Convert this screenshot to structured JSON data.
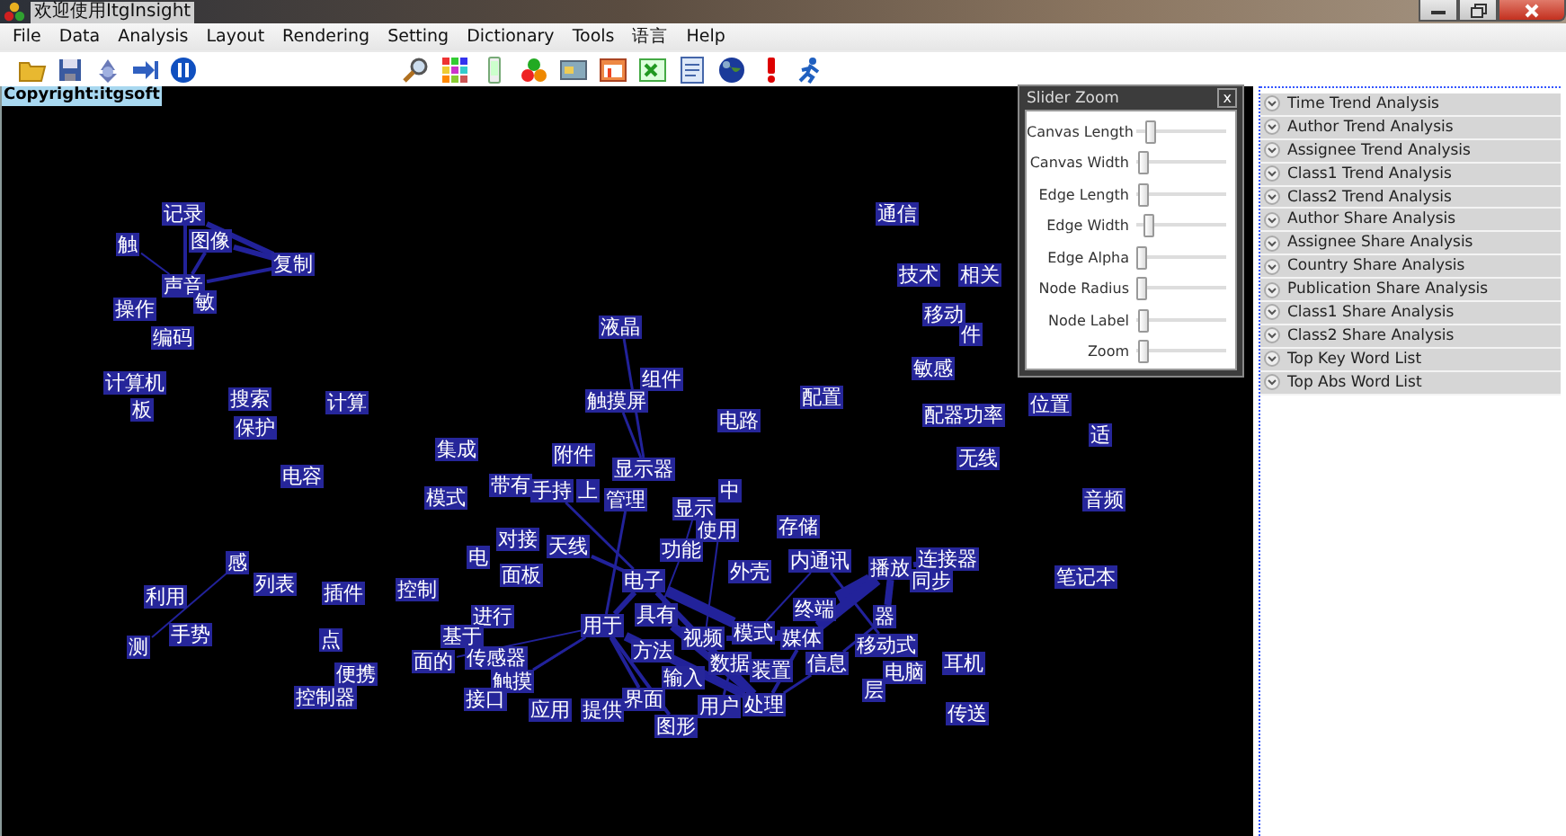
{
  "window": {
    "title": "欢迎使用ItgInsight"
  },
  "menu": [
    "File",
    "Data",
    "Analysis",
    "Layout",
    "Rendering",
    "Setting",
    "Dictionary",
    "Tools",
    "语言",
    "Help"
  ],
  "canvas": {
    "copyright": "Copyright:itgsoft",
    "nodes": [
      {
        "label": "记录"
      },
      {
        "label": "图像"
      },
      {
        "label": "复制"
      },
      {
        "label": "触"
      },
      {
        "label": "声音"
      },
      {
        "label": "敏"
      },
      {
        "label": "操作"
      },
      {
        "label": "编码"
      },
      {
        "label": "计算机"
      },
      {
        "label": "板"
      },
      {
        "label": "搜索"
      },
      {
        "label": "保护"
      },
      {
        "label": "计算"
      },
      {
        "label": "电容"
      },
      {
        "label": "集成"
      },
      {
        "label": "模式"
      },
      {
        "label": "带有"
      },
      {
        "label": "对接"
      },
      {
        "label": "电"
      },
      {
        "label": "面板"
      },
      {
        "label": "列表"
      },
      {
        "label": "插件"
      },
      {
        "label": "控制"
      },
      {
        "label": "感"
      },
      {
        "label": "利用"
      },
      {
        "label": "手势"
      },
      {
        "label": "测"
      },
      {
        "label": "点"
      },
      {
        "label": "便携"
      },
      {
        "label": "控制器"
      },
      {
        "label": "进行"
      },
      {
        "label": "基于"
      },
      {
        "label": "面的"
      },
      {
        "label": "传感器"
      },
      {
        "label": "触摸"
      },
      {
        "label": "接口"
      },
      {
        "label": "应用"
      },
      {
        "label": "提供"
      },
      {
        "label": "液晶"
      },
      {
        "label": "组件"
      },
      {
        "label": "触摸屏"
      },
      {
        "label": "附件"
      },
      {
        "label": "显示器"
      },
      {
        "label": "管理"
      },
      {
        "label": "手持"
      },
      {
        "label": "上"
      },
      {
        "label": "中"
      },
      {
        "label": "显示"
      },
      {
        "label": "使用"
      },
      {
        "label": "天线"
      },
      {
        "label": "功能"
      },
      {
        "label": "电子"
      },
      {
        "label": "外壳"
      },
      {
        "label": "存储"
      },
      {
        "label": "电路"
      },
      {
        "label": "配置"
      },
      {
        "label": "内通讯"
      },
      {
        "label": "具有"
      },
      {
        "label": "用于"
      },
      {
        "label": "方法"
      },
      {
        "label": "视频"
      },
      {
        "label": "模式"
      },
      {
        "label": "输入"
      },
      {
        "label": "数据"
      },
      {
        "label": "装置"
      },
      {
        "label": "界面"
      },
      {
        "label": "图形"
      },
      {
        "label": "用户"
      },
      {
        "label": "处理"
      },
      {
        "label": "终端"
      },
      {
        "label": "媒体"
      },
      {
        "label": "信息"
      },
      {
        "label": "播放"
      },
      {
        "label": "连接器"
      },
      {
        "label": "同步"
      },
      {
        "label": "器"
      },
      {
        "label": "移动式"
      },
      {
        "label": "电脑"
      },
      {
        "label": "层"
      },
      {
        "label": "耳机"
      },
      {
        "label": "传送"
      },
      {
        "label": "通信"
      },
      {
        "label": "技术"
      },
      {
        "label": "相关"
      },
      {
        "label": "移动"
      },
      {
        "label": "件"
      },
      {
        "label": "敏感"
      },
      {
        "label": "配器功率"
      },
      {
        "label": "位置"
      },
      {
        "label": "适"
      },
      {
        "label": "无线"
      },
      {
        "label": "音频"
      },
      {
        "label": "笔记本"
      }
    ]
  },
  "slider_panel": {
    "title": "Slider Zoom",
    "close": "x",
    "sliders": [
      {
        "label": "Canvas Length",
        "level": 0.12
      },
      {
        "label": "Canvas Width",
        "level": 0.03
      },
      {
        "label": "Edge Length",
        "level": 0.02
      },
      {
        "label": "Edge Width",
        "level": 0.08
      },
      {
        "label": "Edge Alpha",
        "level": 0.01
      },
      {
        "label": "Node Radius",
        "level": 0.0
      },
      {
        "label": "Node Label",
        "level": 0.03
      },
      {
        "label": "Zoom",
        "level": 0.03
      }
    ]
  },
  "analysis_panel": {
    "items": [
      {
        "label": "Time Trend Analysis"
      },
      {
        "label": "Author Trend Analysis"
      },
      {
        "label": "Assignee Trend Analysis"
      },
      {
        "label": "Class1 Trend Analysis"
      },
      {
        "label": "Class2 Trend Analysis"
      },
      {
        "label": "Author Share Analysis"
      },
      {
        "label": "Assignee Share Analysis"
      },
      {
        "label": "Country Share Analysis"
      },
      {
        "label": "Publication Share Analysis"
      },
      {
        "label": "Class1 Share Analysis"
      },
      {
        "label": "Class2 Share Analysis"
      },
      {
        "label": "Top Key Word List"
      },
      {
        "label": "Top Abs Word List"
      }
    ]
  }
}
